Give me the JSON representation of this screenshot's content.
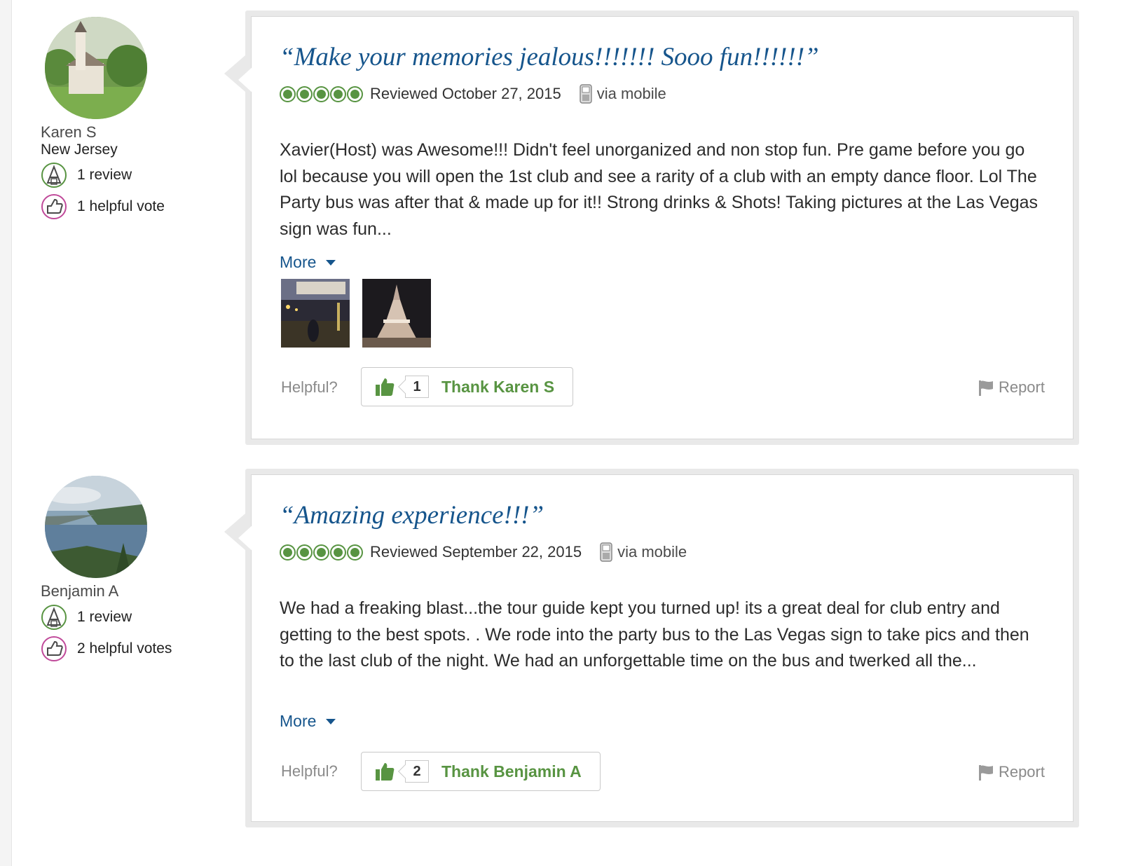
{
  "colors": {
    "link_blue": "#16558c",
    "rating_green": "#589442",
    "muted_gray": "#8a8a8a"
  },
  "reviews": [
    {
      "member": {
        "name": "Karen S",
        "location": "New Jersey",
        "review_count": "1 review",
        "helpful_votes": "1 helpful vote",
        "avatar_icon": "avatar-church-photo"
      },
      "title": "“Make your memories jealous!!!!!!! Sooo fun!!!!!!”",
      "rating": 5,
      "reviewed": "Reviewed October 27, 2015",
      "via": "via mobile",
      "body": "Xavier(Host) was Awesome!!! Didn't feel unorganized and non stop fun. Pre game before you go lol because you will open the 1st club and see a rarity of a club with an empty dance floor. Lol The Party bus was after that & made up for it!! Strong drinks & Shots! Taking pictures at the Las Vegas sign was fun...",
      "more_label": "More",
      "helpful_label": "Helpful?",
      "thank_count": "1",
      "thank_label": "Thank Karen S",
      "report_label": "Report"
    },
    {
      "member": {
        "name": "Benjamin A",
        "review_count": "1 review",
        "helpful_votes": "2 helpful votes",
        "avatar_icon": "avatar-lake-photo"
      },
      "title": "“Amazing experience!!!”",
      "rating": 5,
      "reviewed": "Reviewed September 22, 2015",
      "via": "via mobile",
      "body": "We had a freaking blast...the tour guide kept you turned up! its a great deal for club entry and getting to the best spots. . We rode into the party bus to the Las Vegas sign to take pics and then to the last club of the night. We had an unforgettable time on the bus and twerked all the...",
      "more_label": "More",
      "helpful_label": "Helpful?",
      "thank_count": "2",
      "thank_label": "Thank Benjamin A",
      "report_label": "Report"
    }
  ]
}
